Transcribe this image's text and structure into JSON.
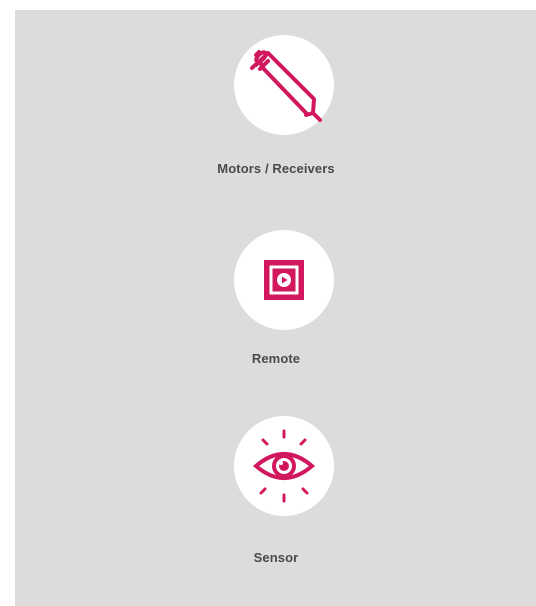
{
  "accent_color": "#d1185f",
  "items": [
    {
      "label": "Motors / Receivers",
      "icon": "motor-tube-icon"
    },
    {
      "label": "Remote",
      "icon": "remote-icon"
    },
    {
      "label": "Sensor",
      "icon": "eye-sensor-icon"
    }
  ]
}
